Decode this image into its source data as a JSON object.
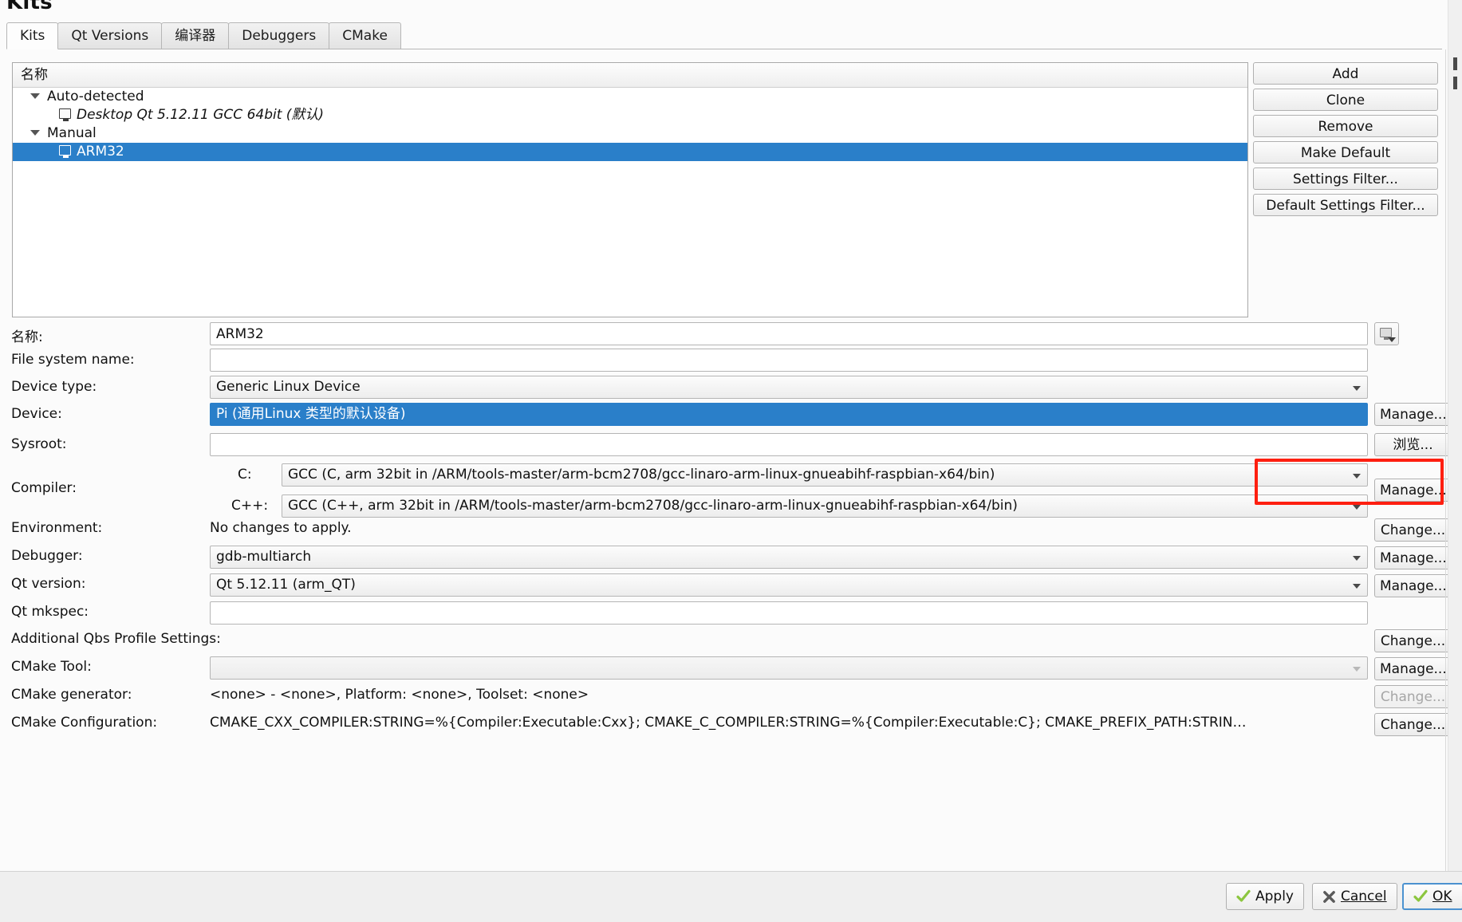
{
  "window": {
    "title": "Kits"
  },
  "tabs": [
    {
      "label": "Kits",
      "active": true
    },
    {
      "label": "Qt Versions",
      "active": false
    },
    {
      "label": "编译器",
      "active": false
    },
    {
      "label": "Debuggers",
      "active": false
    },
    {
      "label": "CMake",
      "active": false
    }
  ],
  "tree": {
    "column_header": "名称",
    "rows": [
      {
        "label": "Auto-detected",
        "type": "group",
        "expanded": true,
        "selected": false
      },
      {
        "label": "Desktop Qt 5.12.11 GCC 64bit (默认)",
        "type": "kit",
        "selected": false
      },
      {
        "label": "Manual",
        "type": "group",
        "expanded": true,
        "selected": false
      },
      {
        "label": "ARM32",
        "type": "kit",
        "selected": true
      }
    ]
  },
  "actions": [
    {
      "label": "Add"
    },
    {
      "label": "Clone"
    },
    {
      "label": "Remove"
    },
    {
      "label": "Make Default"
    },
    {
      "label": "Settings Filter..."
    },
    {
      "label": "Default Settings Filter..."
    }
  ],
  "form": {
    "name": {
      "label": "名称:",
      "value": "ARM32"
    },
    "file_system_name": {
      "label": "File system name:",
      "value": ""
    },
    "device_type": {
      "label": "Device type:",
      "value": "Generic Linux Device"
    },
    "device": {
      "label": "Device:",
      "value": "Pi (通用Linux 类型的默认设备)",
      "button": "Manage...",
      "highlighted": true
    },
    "sysroot": {
      "label": "Sysroot:",
      "value": "",
      "button": "浏览..."
    },
    "compiler": {
      "label": "Compiler:",
      "c_label": "C:",
      "c_value": "GCC (C, arm 32bit in /ARM/tools-master/arm-bcm2708/gcc-linaro-arm-linux-gnueabihf-raspbian-x64/bin)",
      "cpp_label": "C++:",
      "cpp_value": "GCC (C++, arm 32bit in /ARM/tools-master/arm-bcm2708/gcc-linaro-arm-linux-gnueabihf-raspbian-x64/bin)",
      "button": "Manage..."
    },
    "environment": {
      "label": "Environment:",
      "value": "No changes to apply.",
      "button": "Change..."
    },
    "debugger": {
      "label": "Debugger:",
      "value": "gdb-multiarch",
      "button": "Manage..."
    },
    "qt_version": {
      "label": "Qt version:",
      "value": "Qt 5.12.11 (arm_QT)",
      "button": "Manage..."
    },
    "qt_mkspec": {
      "label": "Qt mkspec:",
      "value": ""
    },
    "additional_qbs": {
      "label": "Additional Qbs Profile Settings:",
      "button": "Change..."
    },
    "cmake_tool": {
      "label": "CMake Tool:",
      "value": "",
      "button": "Manage..."
    },
    "cmake_generator": {
      "label": "CMake generator:",
      "value": "<none> - <none>, Platform: <none>, Toolset: <none>",
      "button": "Change...",
      "button_disabled": true
    },
    "cmake_configuration": {
      "label": "CMake Configuration:",
      "value": "CMAKE_CXX_COMPILER:STRING=%{Compiler:Executable:Cxx}; CMAKE_C_COMPILER:STRING=%{Compiler:Executable:C}; CMAKE_PREFIX_PATH:STRIN…",
      "button": "Change..."
    }
  },
  "dialog_buttons": {
    "apply": "Apply",
    "cancel": "Cancel",
    "ok": "OK"
  },
  "colors": {
    "selection": "#2a7fc9",
    "highlight_box": "#fe1f10",
    "check_green": "#8cc63f",
    "cancel_gray": "#5a5a5a"
  }
}
